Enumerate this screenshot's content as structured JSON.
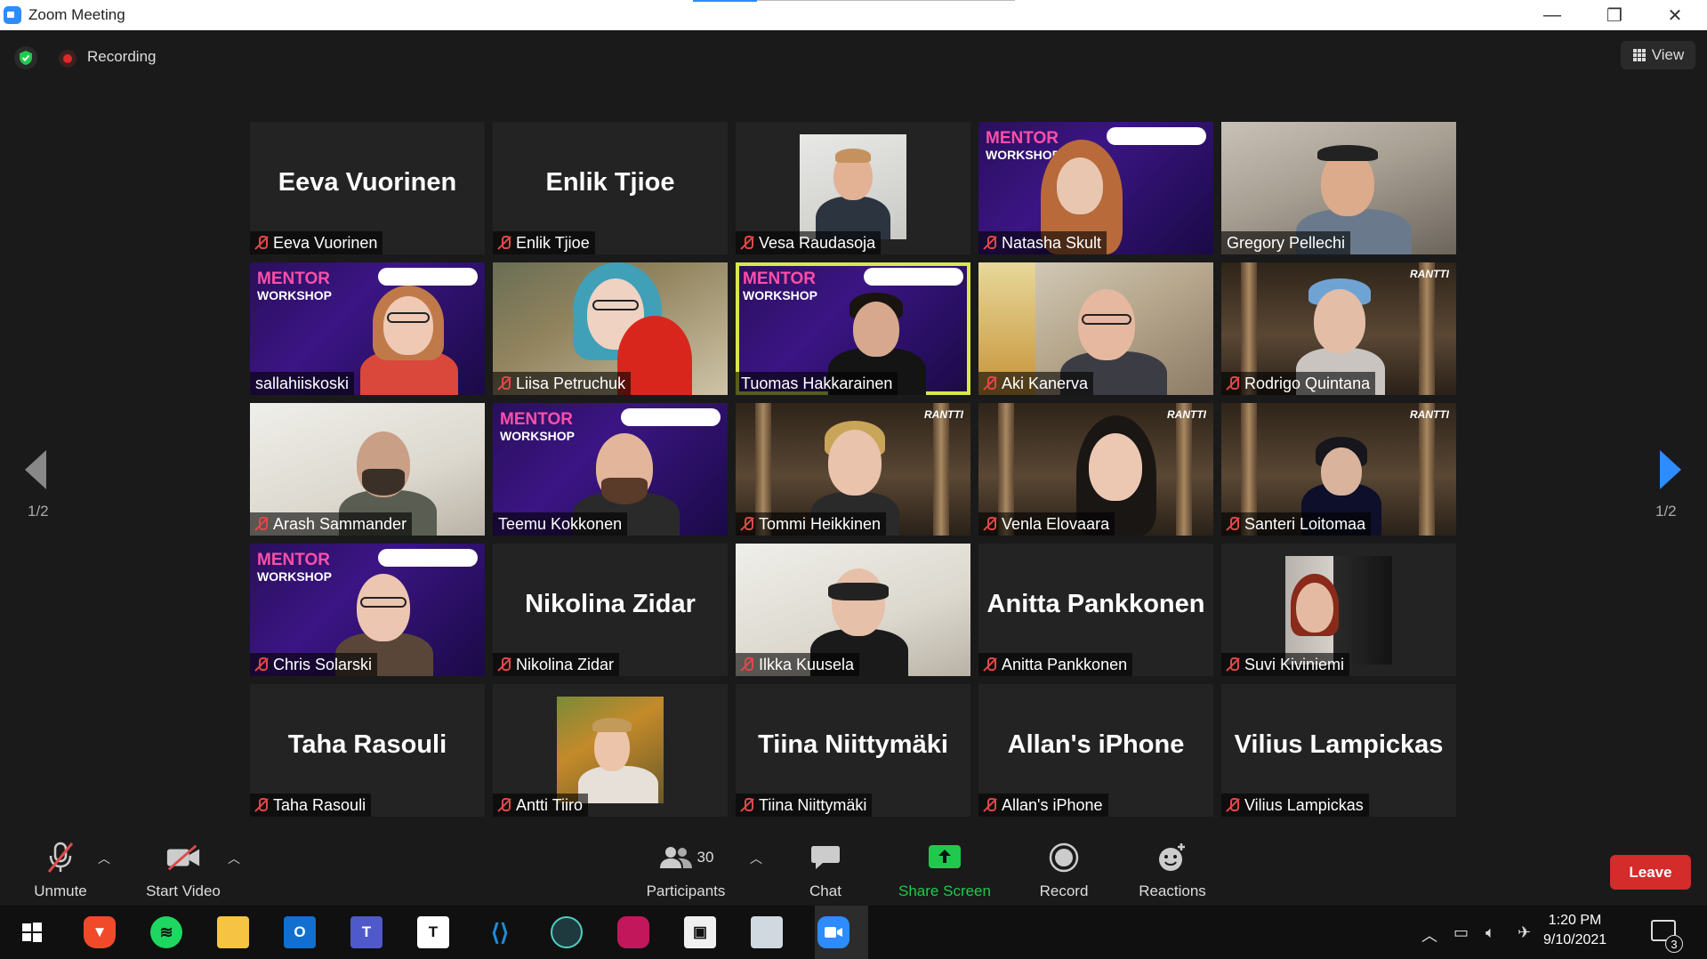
{
  "window": {
    "title": "Zoom Meeting"
  },
  "topbar": {
    "recording_label": "Recording",
    "view_label": "View"
  },
  "pager": {
    "left_page": "1/2",
    "right_page": "1/2"
  },
  "participants": [
    {
      "name": "Eeva Vuorinen",
      "label": "Eeva Vuorinen",
      "video": false,
      "muted": true
    },
    {
      "name": "Enlik Tjioe",
      "label": "Enlik Tjioe",
      "video": false,
      "muted": true
    },
    {
      "name": "Vesa Raudasoja",
      "label": "",
      "video": "portrait",
      "muted": true
    },
    {
      "name": "Natasha Skult",
      "label": "",
      "video": "mentor",
      "muted": true
    },
    {
      "name": "Gregory Pellechi",
      "label": "",
      "video": "room",
      "muted": false
    },
    {
      "name": "sallahiiskoski",
      "label": "",
      "video": "mentor",
      "muted": false
    },
    {
      "name": "Liisa Petruchuk",
      "label": "",
      "video": "green",
      "muted": true
    },
    {
      "name": "Tuomas Hakkarainen",
      "label": "",
      "video": "mentor",
      "muted": false,
      "active_speaker": true
    },
    {
      "name": "Aki Kanerva",
      "label": "",
      "video": "shelf",
      "muted": true
    },
    {
      "name": "Rodrigo Quintana",
      "label": "",
      "video": "library",
      "muted": true
    },
    {
      "name": "Arash Sammander",
      "label": "",
      "video": "white",
      "muted": true
    },
    {
      "name": "Teemu Kokkonen",
      "label": "",
      "video": "mentor",
      "muted": false
    },
    {
      "name": "Tommi Heikkinen",
      "label": "",
      "video": "library",
      "muted": true
    },
    {
      "name": "Venla Elovaara",
      "label": "",
      "video": "library",
      "muted": true
    },
    {
      "name": "Santeri Loitomaa",
      "label": "",
      "video": "library",
      "muted": true
    },
    {
      "name": "Chris Solarski",
      "label": "",
      "video": "mentor",
      "muted": true
    },
    {
      "name": "Nikolina Zidar",
      "label": "Nikolina Zidar",
      "video": false,
      "muted": true
    },
    {
      "name": "Ilkka Kuusela",
      "label": "",
      "video": "white",
      "muted": true
    },
    {
      "name": "Anitta Pankkonen",
      "label": "Anitta Pankkonen",
      "video": false,
      "muted": true
    },
    {
      "name": "Suvi Kiviniemi",
      "label": "",
      "video": "portrait",
      "muted": true
    },
    {
      "name": "Taha Rasouli",
      "label": "Taha Rasouli",
      "video": false,
      "muted": true
    },
    {
      "name": "Antti Tiiro",
      "label": "",
      "video": "portrait",
      "muted": true
    },
    {
      "name": "Tiina Niittymäki",
      "label": "Tiina Niittymäki",
      "video": false,
      "muted": true
    },
    {
      "name": "Allan's iPhone",
      "label": "Allan's iPhone",
      "video": false,
      "muted": true
    },
    {
      "name": "Vilius Lampickas",
      "label": "Vilius Lampickas",
      "video": false,
      "muted": true
    }
  ],
  "mentor_overlay": {
    "line1": "MENTOR",
    "line2": "WORKSHOP"
  },
  "library_tag": "RANTTI",
  "toolbar": {
    "unmute_label": "Unmute",
    "start_video_label": "Start Video",
    "participants_label": "Participants",
    "participants_count": "30",
    "chat_label": "Chat",
    "share_screen_label": "Share Screen",
    "record_label": "Record",
    "reactions_label": "Reactions",
    "leave_label": "Leave"
  },
  "taskbar": {
    "time": "1:20 PM",
    "date": "9/10/2021",
    "notification_count": "3"
  },
  "colors": {
    "accent": "#2d8cff",
    "share_green": "#20c94d",
    "leave_red": "#d42b2b",
    "active_speaker": "#d8e84a",
    "muted_red": "#e04848"
  }
}
